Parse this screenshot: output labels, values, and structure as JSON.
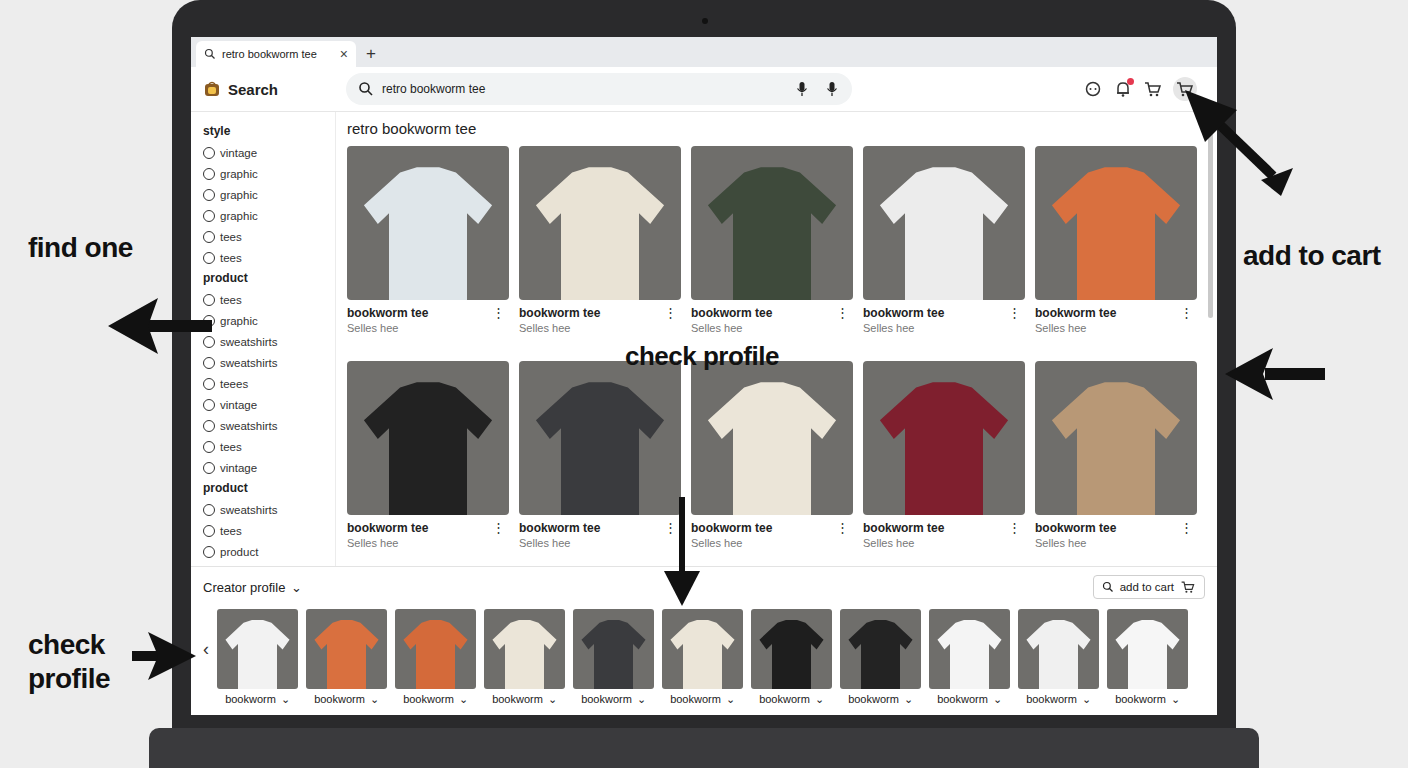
{
  "browser_tab": {
    "title": "retro bookworm tee",
    "close": "×",
    "new_tab": "+"
  },
  "header": {
    "logo": "Search",
    "search": {
      "value": "retro bookworm tee"
    },
    "notification_dot": true,
    "cart_highlighted": true
  },
  "sidebar": {
    "groups": [
      {
        "title": "style",
        "items": [
          {
            "label": "vintage",
            "checked": false
          },
          {
            "label": "graphic",
            "checked": false
          },
          {
            "label": "graphic",
            "checked": false
          },
          {
            "label": "graphic",
            "checked": false
          },
          {
            "label": "tees",
            "checked": false
          },
          {
            "label": "tees",
            "checked": false
          }
        ]
      },
      {
        "title": "product",
        "items": [
          {
            "label": "tees",
            "checked": false
          },
          {
            "label": "graphic",
            "checked": false
          },
          {
            "label": "sweatshirts",
            "checked": false
          },
          {
            "label": "sweatshirts",
            "checked": false
          },
          {
            "label": "teees",
            "checked": false
          },
          {
            "label": "vintage",
            "checked": false
          },
          {
            "label": "sweatshirts",
            "checked": false
          },
          {
            "label": "tees",
            "checked": false
          },
          {
            "label": "vintage",
            "checked": false
          }
        ]
      },
      {
        "title": "product",
        "items": [
          {
            "label": "sweatshirts",
            "checked": false
          },
          {
            "label": "tees",
            "checked": false
          },
          {
            "label": "product",
            "checked": false
          }
        ]
      }
    ]
  },
  "results": {
    "title": "retro bookworm tee",
    "more": "⋮",
    "cards": [
      {
        "title": "bookworm tee",
        "seller": "Selles hee",
        "color": "#dfe6ea"
      },
      {
        "title": "bookworm tee",
        "seller": "Selles hee",
        "color": "#e9e3d5"
      },
      {
        "title": "bookworm tee",
        "seller": "Selles hee",
        "color": "#3e4a3b"
      },
      {
        "title": "bookworm tee",
        "seller": "Selles hee",
        "color": "#ececec"
      },
      {
        "title": "bookworm tee",
        "seller": "Selles hee",
        "color": "#d9703f"
      },
      {
        "title": "bookworm tee",
        "seller": "Selles hee",
        "color": "#222222"
      },
      {
        "title": "bookworm tee",
        "seller": "Selles hee",
        "color": "#3a3b3e"
      },
      {
        "title": "bookworm tee",
        "seller": "Selles hee",
        "color": "#ebe5d8"
      },
      {
        "title": "bookworm tee",
        "seller": "Selles hee",
        "color": "#7f1f2e"
      },
      {
        "title": "bookworm tee",
        "seller": "Selles hee",
        "color": "#b89876"
      }
    ]
  },
  "creator_strip": {
    "title": "Creator profile",
    "toggle": "⌄",
    "button": "add to cart",
    "prev": "‹",
    "items": [
      {
        "label": "bookworm",
        "chevron": "⌄",
        "color": "#f2f2f2"
      },
      {
        "label": "bookworm",
        "chevron": "⌄",
        "color": "#d9703f"
      },
      {
        "label": "bookworm",
        "chevron": "⌄",
        "color": "#d46a3a"
      },
      {
        "label": "bookworm",
        "chevron": "⌄",
        "color": "#ebe5d8"
      },
      {
        "label": "bookworm",
        "chevron": "⌄",
        "color": "#3a3b3e"
      },
      {
        "label": "bookworm",
        "chevron": "⌄",
        "color": "#ebe5d8"
      },
      {
        "label": "bookworm",
        "chevron": "⌄",
        "color": "#1e1e1e"
      },
      {
        "label": "bookworm",
        "chevron": "⌄",
        "color": "#232323"
      },
      {
        "label": "bookworm",
        "chevron": "⌄",
        "color": "#f4f4f4"
      },
      {
        "label": "bookworm",
        "chevron": "⌄",
        "color": "#f0f0f0"
      },
      {
        "label": "bookworm",
        "chevron": "⌄",
        "color": "#f6f6f6"
      }
    ]
  },
  "annotations": {
    "find_one": "find one",
    "add_to_cart": "add to cart",
    "check_profile_center": "check profile",
    "check_profile_left": "check profile"
  }
}
